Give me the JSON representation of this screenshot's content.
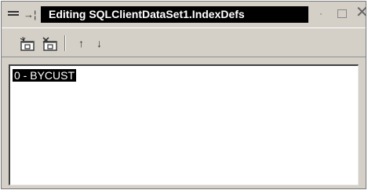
{
  "window": {
    "title": "Editing SQLClientDataSet1.IndexDefs"
  },
  "titlebar": {
    "menu_icon": "system-menu-icon",
    "pin_icon": "pin-icon",
    "pin_glyph": "→¦",
    "minimize_glyph": "·",
    "close_glyph": "✕"
  },
  "toolbar": {
    "items": [
      {
        "name": "add-new-button",
        "icon": "add-new-icon"
      },
      {
        "name": "delete-button",
        "icon": "delete-icon"
      },
      {
        "name": "move-up-button",
        "icon": "arrow-up-icon",
        "glyph": "↑"
      },
      {
        "name": "move-down-button",
        "icon": "arrow-down-icon",
        "glyph": "↓"
      }
    ]
  },
  "list": {
    "items": [
      "0 - BYCUST"
    ],
    "selected_index": 0
  },
  "colors": {
    "face": "#d4d0c8",
    "title_bg": "#000000",
    "title_fg": "#ffffff",
    "selection_bg": "#000000"
  }
}
